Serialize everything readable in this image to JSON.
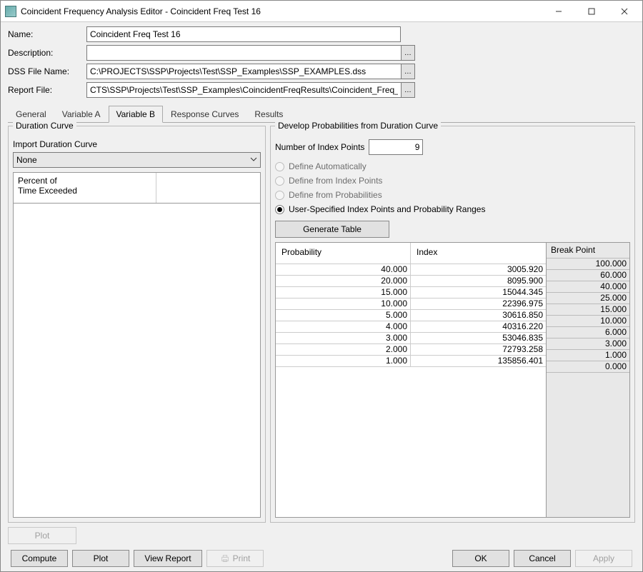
{
  "window": {
    "title": "Coincident Frequency Analysis Editor - Coincident Freq Test 16"
  },
  "form": {
    "name_label": "Name:",
    "name_value": "Coincident Freq Test 16",
    "description_label": "Description:",
    "description_value": "",
    "dss_label": "DSS File Name:",
    "dss_value": "C:\\PROJECTS\\SSP\\Projects\\Test\\SSP_Examples\\SSP_EXAMPLES.dss",
    "report_label": "Report File:",
    "report_value": "CTS\\SSP\\Projects\\Test\\SSP_Examples\\CoincidentFreqResults\\Coincident_Freq_T..."
  },
  "tabs": {
    "items": [
      "General",
      "Variable A",
      "Variable B",
      "Response Curves",
      "Results"
    ],
    "active_index": 2
  },
  "left_panel": {
    "legend": "Duration Curve",
    "import_label": "Import Duration Curve",
    "combo_value": "None",
    "grid_col_left": "Percent of\nTime Exceeded"
  },
  "right_panel": {
    "legend": "Develop Probabilities from Duration Curve",
    "num_idx_label": "Number of Index Points",
    "num_idx_value": "9",
    "radios": {
      "r1": "Define Automatically",
      "r2": "Define from Index Points",
      "r3": "Define from Probabilities",
      "r4": "User-Specified Index Points and Probability Ranges"
    },
    "gen_btn": "Generate Table",
    "headers": {
      "prob": "Probability",
      "index": "Index",
      "bp": "Break Point"
    },
    "rows": [
      {
        "prob": "40.000",
        "index": "3005.920"
      },
      {
        "prob": "20.000",
        "index": "8095.900"
      },
      {
        "prob": "15.000",
        "index": "15044.345"
      },
      {
        "prob": "10.000",
        "index": "22396.975"
      },
      {
        "prob": "5.000",
        "index": "30616.850"
      },
      {
        "prob": "4.000",
        "index": "40316.220"
      },
      {
        "prob": "3.000",
        "index": "53046.835"
      },
      {
        "prob": "2.000",
        "index": "72793.258"
      },
      {
        "prob": "1.000",
        "index": "135856.401"
      }
    ],
    "breakpoints": [
      "100.000",
      "60.000",
      "40.000",
      "25.000",
      "15.000",
      "10.000",
      "6.000",
      "3.000",
      "1.000",
      "0.000"
    ]
  },
  "bottom": {
    "plot_disabled": "Plot",
    "compute": "Compute",
    "plot": "Plot",
    "view_report": "View Report",
    "print": "Print",
    "ok": "OK",
    "cancel": "Cancel",
    "apply": "Apply"
  }
}
